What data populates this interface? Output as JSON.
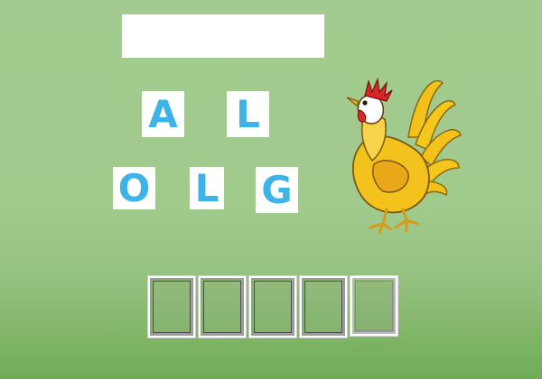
{
  "answer": {
    "text": ""
  },
  "tiles": [
    {
      "letter": "A"
    },
    {
      "letter": "L"
    },
    {
      "letter": "O"
    },
    {
      "letter": "L"
    },
    {
      "letter": "G"
    }
  ],
  "slots": [
    {
      "letter": ""
    },
    {
      "letter": ""
    },
    {
      "letter": ""
    },
    {
      "letter": ""
    },
    {
      "letter": ""
    }
  ],
  "image": {
    "subject": "rooster",
    "icon": "rooster-icon"
  },
  "colors": {
    "background_top": "#a3cb8f",
    "background_bottom": "#6fac54",
    "tile_letter": "#3eb3e8",
    "tile_background": "#ffffff",
    "slot_border": "#9a9a9a"
  }
}
